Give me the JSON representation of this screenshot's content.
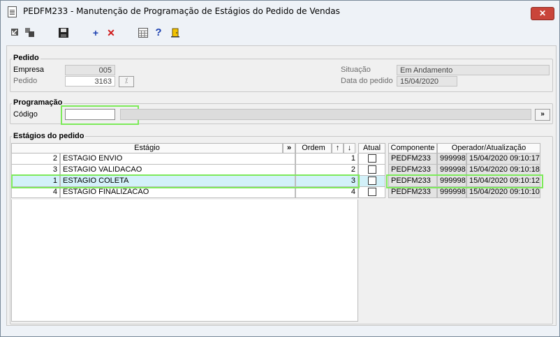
{
  "window": {
    "title": "PEDFM233 - Manutenção de Programação de Estágios do Pedido de Vendas",
    "close_label": "✕"
  },
  "toolbar": {
    "items": [
      {
        "name": "prev-record-icon"
      },
      {
        "name": "next-record-icon"
      },
      {
        "name": "save-icon"
      },
      {
        "name": "add-icon",
        "glyph": "+"
      },
      {
        "name": "delete-icon",
        "glyph": "✕"
      },
      {
        "name": "calculator-icon"
      },
      {
        "name": "help-icon",
        "glyph": "?"
      },
      {
        "name": "exit-icon"
      }
    ]
  },
  "pedido": {
    "group_label": "Pedido",
    "empresa_label": "Empresa",
    "empresa_value": "005",
    "pedido_label": "Pedido",
    "pedido_value": "3163",
    "situacao_label": "Situação",
    "situacao_value": "Em Andamento",
    "data_label": "Data do pedido",
    "data_value": "15/04/2020"
  },
  "programacao": {
    "group_label": "Programação",
    "codigo_label": "Código",
    "codigo_value": "",
    "descricao_value": "",
    "lookup_label": "»"
  },
  "estagios": {
    "group_label": "Estágios do pedido",
    "columns": {
      "estagio": "Estágio",
      "expand": "»",
      "ordem": "Ordem",
      "up": "↑",
      "down": "↓",
      "atual": "Atual",
      "componente": "Componente",
      "operador": "Operador/Atualização"
    },
    "rows": [
      {
        "id": "2",
        "estagio": "ESTAGIO ENVIO",
        "ordem": "1",
        "atual": false,
        "componente": "PEDFM233",
        "operador": "999998",
        "atualizacao": "15/04/2020 09:10:17"
      },
      {
        "id": "3",
        "estagio": "ESTAGIO VALIDACAO",
        "ordem": "2",
        "atual": false,
        "componente": "PEDFM233",
        "operador": "999998",
        "atualizacao": "15/04/2020 09:10:18"
      },
      {
        "id": "1",
        "estagio": "ESTAGIO COLETA",
        "ordem": "3",
        "atual": false,
        "componente": "PEDFM233",
        "operador": "999998",
        "atualizacao": "15/04/2020 09:10:12",
        "selected": true
      },
      {
        "id": "4",
        "estagio": "ESTAGIO FINALIZACAO",
        "ordem": "4",
        "atual": false,
        "componente": "PEDFM233",
        "operador": "999998",
        "atualizacao": "15/04/2020 09:10:10"
      }
    ]
  },
  "colors": {
    "selected_row": "#d3f1f9",
    "highlight": "#7dea5a",
    "close_button": "#c9453a"
  }
}
